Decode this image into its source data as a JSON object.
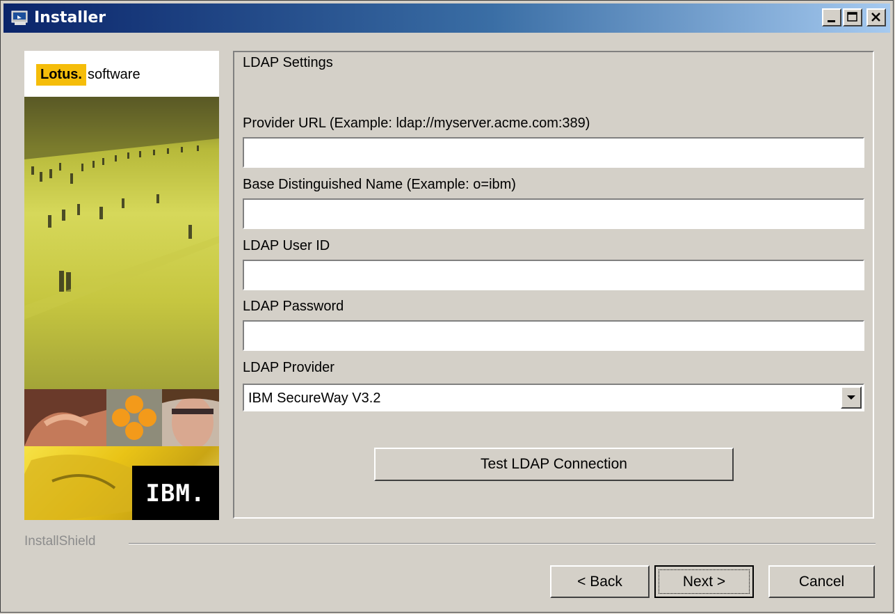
{
  "window": {
    "title": "Installer",
    "minimize_label": "",
    "maximize_label": "",
    "close_label": ""
  },
  "branding": {
    "lotus": "Lotus.",
    "software": "software",
    "ibm": "IBM."
  },
  "panel": {
    "heading": "LDAP Settings",
    "fields": [
      {
        "label": "Provider URL (Example: ldap://myserver.acme.com:389)",
        "value": ""
      },
      {
        "label": "Base Distinguished Name (Example: o=ibm)",
        "value": ""
      },
      {
        "label": "LDAP User ID",
        "value": ""
      },
      {
        "label": "LDAP Password",
        "value": ""
      }
    ],
    "provider_label": "LDAP Provider",
    "provider_value": "IBM SecureWay V3.2",
    "test_button": "Test LDAP Connection"
  },
  "footer": {
    "brand": "InstallShield",
    "back": "< Back",
    "next": "Next >",
    "cancel": "Cancel"
  },
  "colors": {
    "face": "#d4d0c8",
    "title_start": "#0a246a",
    "title_end": "#a6caf0",
    "lotus_yellow": "#f5bd0a"
  },
  "icons": [
    "installer-icon",
    "minimize-icon",
    "maximize-icon",
    "close-icon",
    "dropdown-arrow-icon"
  ]
}
